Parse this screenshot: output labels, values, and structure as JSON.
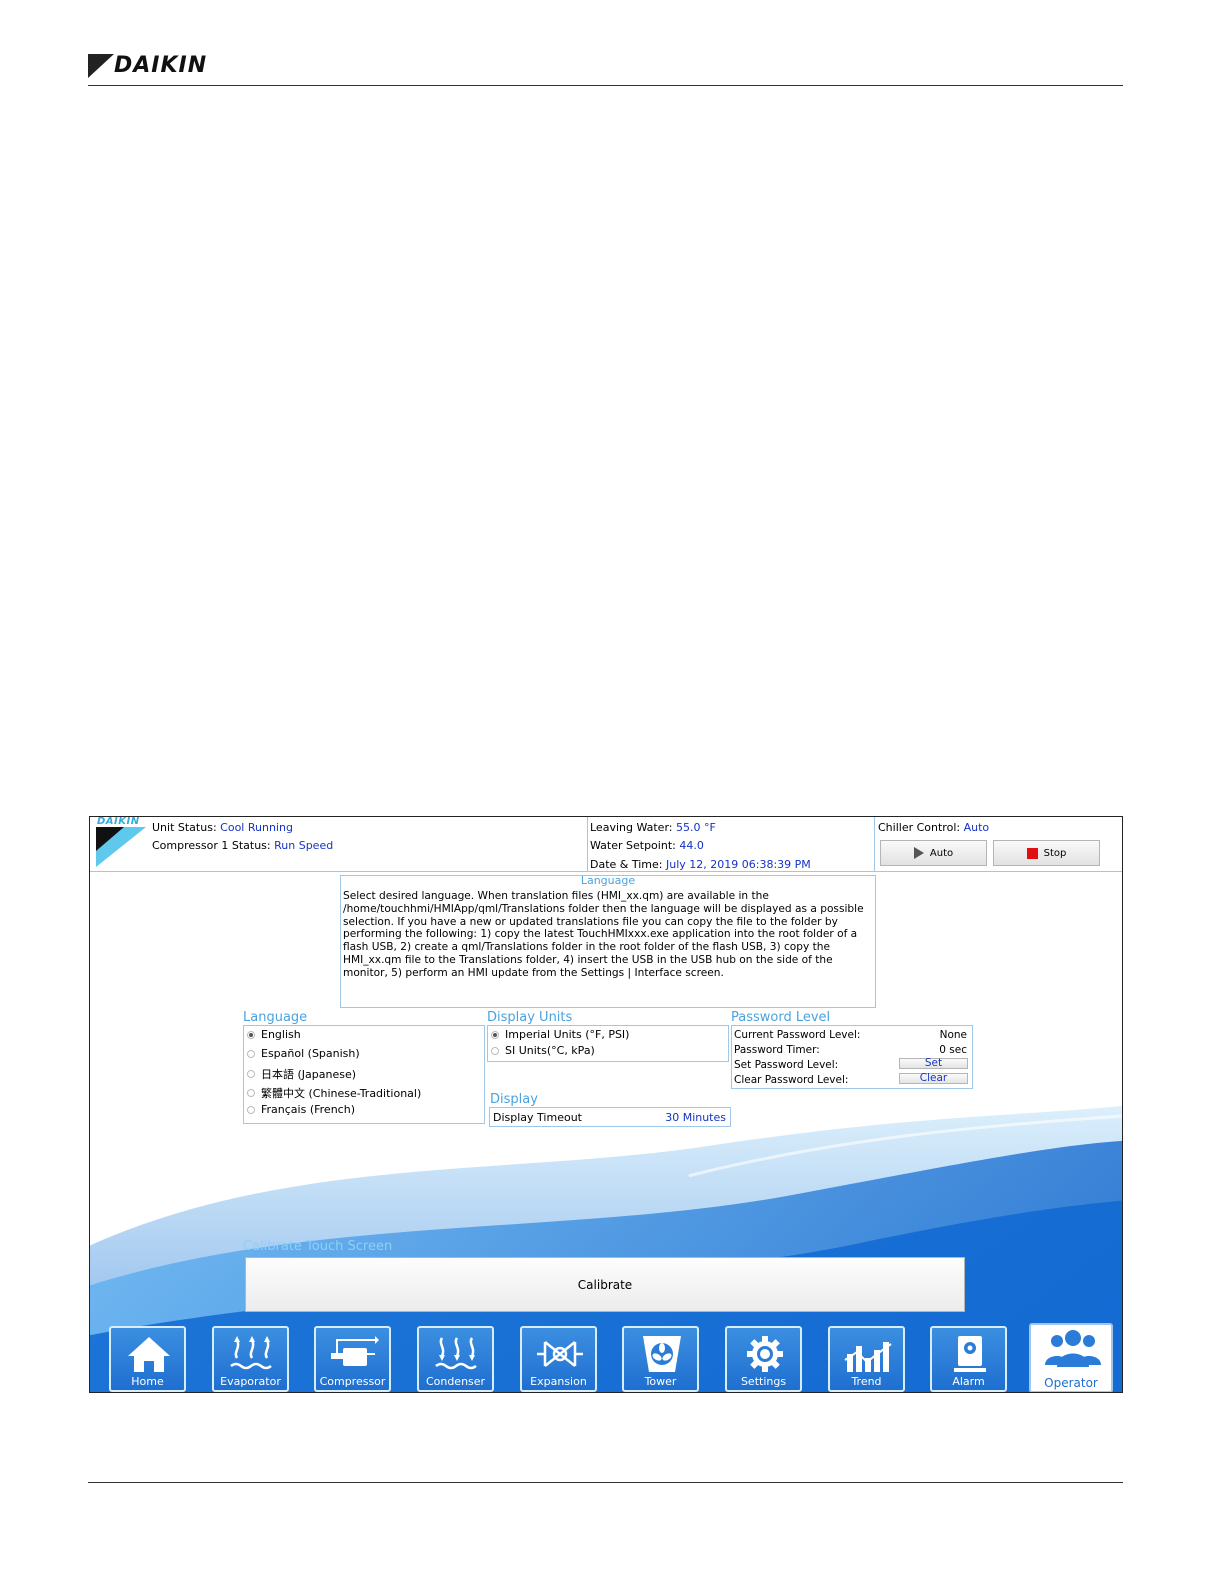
{
  "page": {
    "brand": "DAIKIN"
  },
  "screen": {
    "logo_text": "DAIKIN",
    "header": {
      "unit_status_label": "Unit Status:",
      "unit_status_value": "Cool Running",
      "compressor_label": "Compressor 1 Status:",
      "compressor_value": "Run Speed",
      "leaving_water_label": "Leaving Water:",
      "leaving_water_value": "55.0 °F",
      "water_setpoint_label": "Water Setpoint:",
      "water_setpoint_value": "44.0",
      "datetime_label": "Date & Time:",
      "datetime_value": "July 12, 2019  06:38:39 PM",
      "chiller_control_label": "Chiller Control:",
      "chiller_control_value": "Auto",
      "auto_button": "Auto",
      "stop_button": "Stop"
    },
    "language_info": {
      "title": "Language",
      "text": "Select desired language.  When translation files (HMI_xx.qm) are available in the /home/touchhmi/HMIApp/qml/Translations folder then the language will be displayed as a possible selection.  If you have a new or updated translations file you can copy the file to the folder by performing the following: 1) copy the latest TouchHMIxxx.exe application into the root folder of a flash USB, 2) create a qml/Translations folder in the root folder of the flash USB, 3) copy the HMI_xx.qm file to the Translations folder, 4) insert the USB in the USB hub on the side of the monitor, 5) perform an HMI update from the Settings | Interface screen."
    },
    "language": {
      "title": "Language",
      "options": [
        "English",
        "Español (Spanish)",
        "日本語 (Japanese)",
        "繁體中文 (Chinese-Traditional)",
        "Français (French)"
      ],
      "selected_index": 0
    },
    "display_units": {
      "title": "Display Units",
      "options": [
        "Imperial Units (°F, PSI)",
        "SI Units(°C, kPa)"
      ],
      "selected_index": 0
    },
    "display": {
      "title": "Display",
      "timeout_label": "Display Timeout",
      "timeout_value": "30 Minutes"
    },
    "password": {
      "title": "Password Level",
      "current_label": "Current Password Level:",
      "current_value": "None",
      "timer_label": "Password Timer:",
      "timer_value": "0 sec",
      "set_label": "Set Password Level:",
      "set_button": "Set",
      "clear_label": "Clear Password Level:",
      "clear_button": "Clear"
    },
    "calibrate": {
      "title": "Calibrate Touch Screen",
      "button": "Calibrate"
    },
    "nav": [
      {
        "label": "Home",
        "icon": "home-icon"
      },
      {
        "label": "Evaporator",
        "icon": "evaporator-icon"
      },
      {
        "label": "Compressor",
        "icon": "compressor-icon"
      },
      {
        "label": "Condenser",
        "icon": "condenser-icon"
      },
      {
        "label": "Expansion",
        "icon": "expansion-valve-icon"
      },
      {
        "label": "Tower",
        "icon": "tower-fan-icon"
      },
      {
        "label": "Settings",
        "icon": "gear-icon"
      },
      {
        "label": "Trend",
        "icon": "trend-chart-icon"
      },
      {
        "label": "Alarm",
        "icon": "alarm-icon"
      },
      {
        "label": "Operator",
        "icon": "operator-group-icon"
      }
    ],
    "colors": {
      "accent": "#1f6fd0",
      "value": "#1433c4",
      "title": "#4aa3df",
      "stop": "#e01010"
    }
  }
}
